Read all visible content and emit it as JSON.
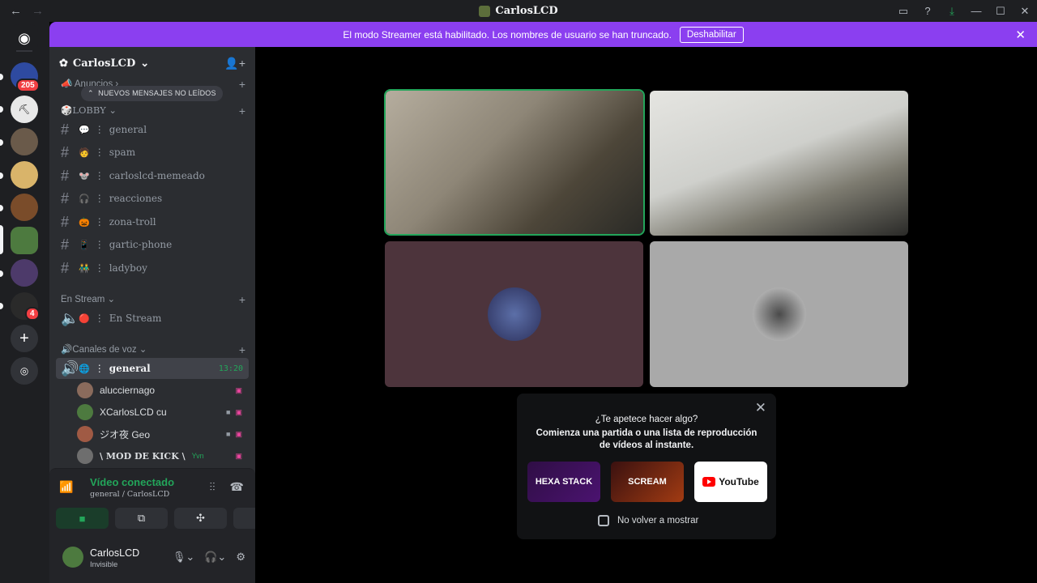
{
  "window": {
    "title": "CarlosLCD"
  },
  "banner": {
    "text": "El modo Streamer está habilitado. Los nombres de usuario se han truncado.",
    "button": "Deshabilitar"
  },
  "rail": {
    "badges": [
      "205",
      "4"
    ]
  },
  "guild": {
    "name": "CarlosLCD",
    "unread_pill": "NUEVOS MENSAJES NO LEÍDOS",
    "categories": {
      "anuncios": "Anuncios",
      "lobby": "LOBBY",
      "stream": "En Stream",
      "voz": "Canales de voz"
    },
    "channels": [
      {
        "emoji": "💬",
        "name": "general"
      },
      {
        "emoji": "🧑",
        "name": "spam"
      },
      {
        "emoji": "🐭",
        "name": "carloslcd-memeado"
      },
      {
        "emoji": "🎧",
        "name": "reacciones"
      },
      {
        "emoji": "🎃",
        "name": "zona-troll"
      },
      {
        "emoji": "📱",
        "name": "gartic-phone"
      },
      {
        "emoji": "👬",
        "name": "ladyboy"
      }
    ],
    "stream_channel": {
      "emoji": "🔴",
      "name": "En Stream"
    },
    "voice_channel": {
      "emoji": "🌐",
      "name": "general",
      "time": "13:20"
    },
    "voice_users": [
      {
        "name": "alucciernago",
        "color": "#8a6b5c"
      },
      {
        "name": "XCarlosLCD cu",
        "color": "#4d7a3f"
      },
      {
        "name": "ジオ夜 Geo",
        "color": "#a05a44"
      },
      {
        "name": "\\ MOD DE KICK \\",
        "color": "#6e6e6e",
        "tag": "Yvn"
      }
    ]
  },
  "voice_panel": {
    "status": "Vídeo conectado",
    "sub": "general / CarlosLCD"
  },
  "user_panel": {
    "name": "CarlosLCD",
    "status": "Invisible"
  },
  "popup": {
    "question": "¿Te apetece hacer algo?",
    "message": "Comienza una partida o una lista de reproducción de vídeos al instante.",
    "activities": [
      "HEXA STACK",
      "SCREAM",
      "YouTube"
    ],
    "checkbox": "No volver a mostrar"
  },
  "colors": {
    "banner": "#8b3ff0",
    "connected": "#23a55a",
    "active_tile_border": "#23a55a"
  }
}
